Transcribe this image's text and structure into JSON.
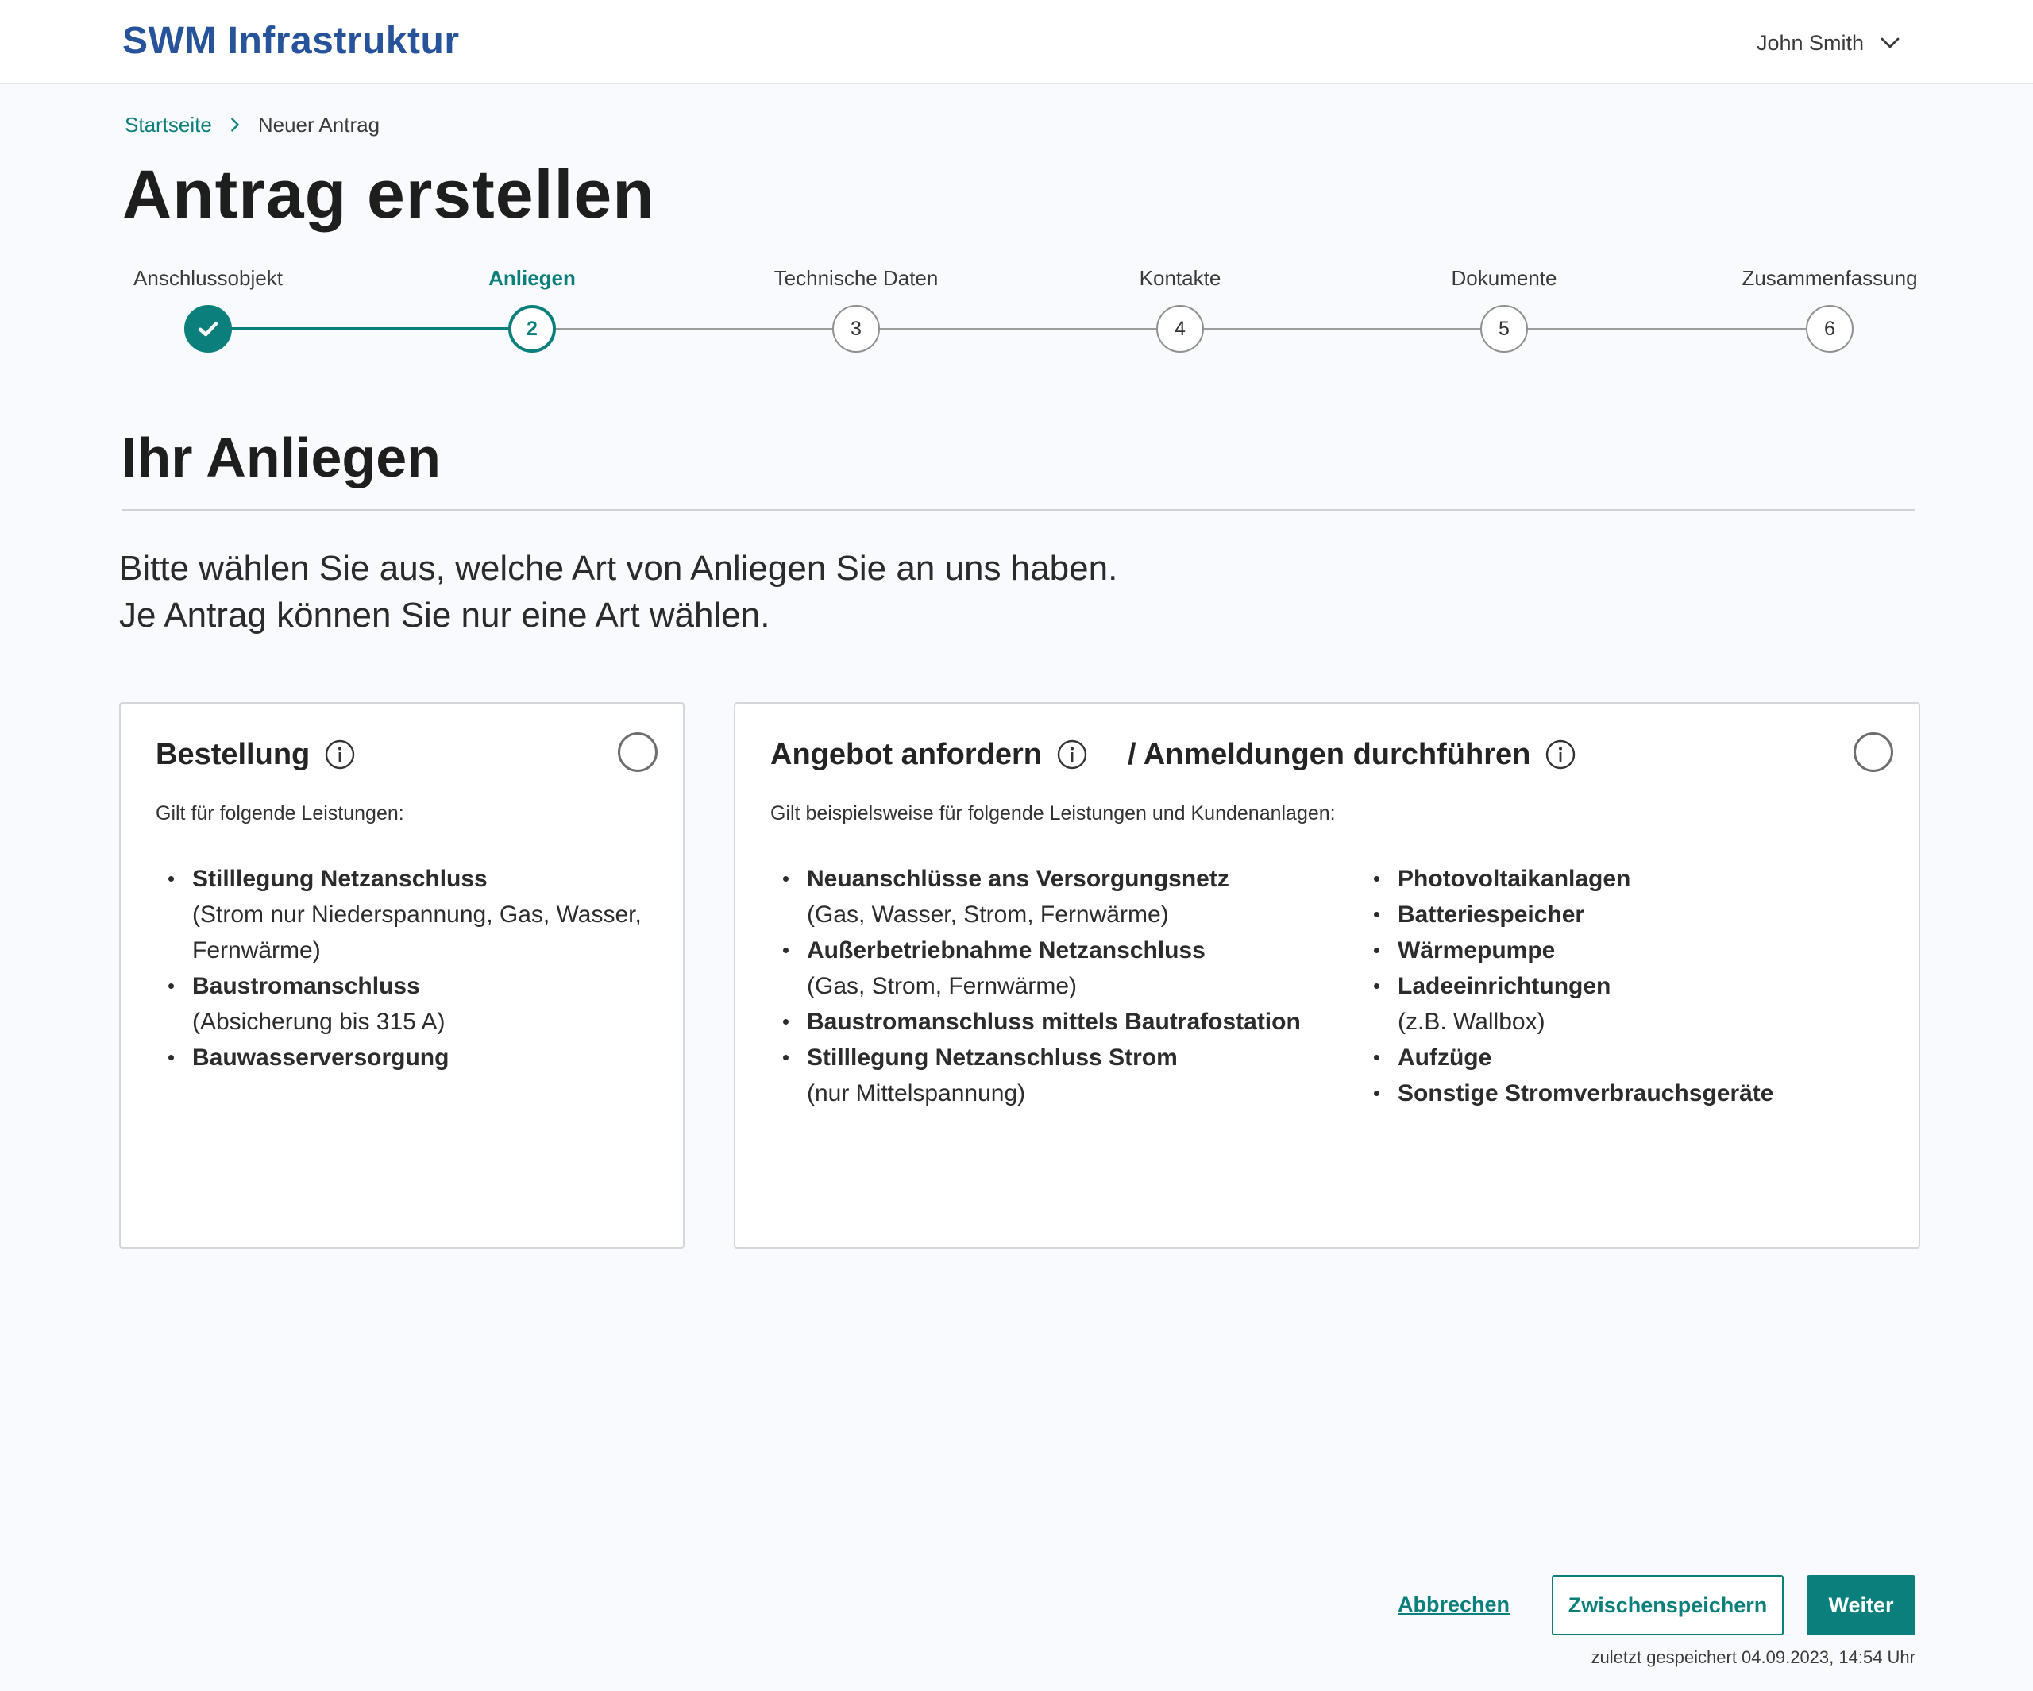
{
  "header": {
    "brand": "SWM Infrastruktur",
    "user_name": "John Smith"
  },
  "breadcrumb": {
    "home": "Startseite",
    "current": "Neuer Antrag"
  },
  "page_title": "Antrag erstellen",
  "stepper": {
    "current_step": 2,
    "steps": [
      {
        "label": "Anschlussobjekt",
        "number": "1",
        "status": "done"
      },
      {
        "label": "Anliegen",
        "number": "2",
        "status": "active"
      },
      {
        "label": "Technische Daten",
        "number": "3",
        "status": "upcoming"
      },
      {
        "label": "Kontakte",
        "number": "4",
        "status": "upcoming"
      },
      {
        "label": "Dokumente",
        "number": "5",
        "status": "upcoming"
      },
      {
        "label": "Zusammenfassung",
        "number": "6",
        "status": "upcoming"
      }
    ]
  },
  "section": {
    "title": "Ihr Anliegen",
    "intro_line1": "Bitte wählen Sie aus, welche Art von Anliegen Sie an uns haben.",
    "intro_line2": "Je Antrag können Sie nur eine Art wählen."
  },
  "options": {
    "bestellung": {
      "title": "Bestellung",
      "selected": false,
      "subtitle": "Gilt für folgende Leistungen:",
      "items": [
        {
          "name": "Stilllegung Netzanschluss",
          "note": "(Strom nur Niederspannung, Gas, Wasser, Fernwärme)"
        },
        {
          "name": "Baustromanschluss",
          "note": "(Absicherung bis 315 A)"
        },
        {
          "name": "Bauwasserversorgung",
          "note": ""
        }
      ]
    },
    "angebot": {
      "title_part1": "Angebot anfordern",
      "title_part2": "/ Anmeldungen durchführen",
      "selected": false,
      "subtitle": "Gilt beispielsweise für folgende Leistungen und Kundenanlagen:",
      "items_col1": [
        {
          "name": "Neuanschlüsse ans Versorgungsnetz",
          "note": "(Gas, Wasser, Strom, Fernwärme)"
        },
        {
          "name": "Außerbetriebnahme Netzanschluss",
          "note": "(Gas, Strom, Fernwärme)"
        },
        {
          "name": "Baustromanschluss mittels Bautrafostation",
          "note": ""
        },
        {
          "name": "Stilllegung Netzanschluss Strom",
          "note": "(nur Mittelspannung)"
        }
      ],
      "items_col2": [
        {
          "name": "Photovoltaikanlagen",
          "note": ""
        },
        {
          "name": "Batteriespeicher",
          "note": ""
        },
        {
          "name": "Wärmepumpe",
          "note": ""
        },
        {
          "name": "Ladeeinrichtungen",
          "note": "(z.B. Wallbox)"
        },
        {
          "name": "Aufzüge",
          "note": ""
        },
        {
          "name": "Sonstige Stromverbrauchsgeräte",
          "note": ""
        }
      ]
    }
  },
  "actions": {
    "cancel": "Abbrechen",
    "save": "Zwischenspeichern",
    "next": "Weiter",
    "last_saved": "zuletzt gespeichert 04.09.2023, 14:54 Uhr"
  },
  "colors": {
    "brand": "#27539b",
    "accent": "#0b7f7b",
    "background": "#f9fafd"
  },
  "icons": {
    "user_menu": "chevron-down-icon",
    "breadcrumb_separator": "chevron-right-icon",
    "step_done": "check-icon",
    "option_info": "info-icon"
  }
}
